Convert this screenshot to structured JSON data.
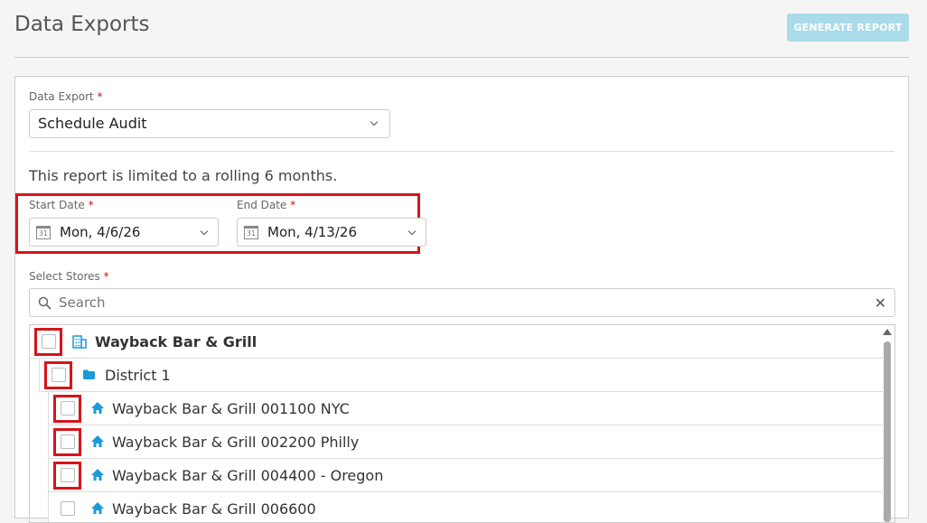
{
  "header": {
    "title": "Data Exports",
    "generate_label": "GENERATE REPORT"
  },
  "form": {
    "export_label": "Data Export",
    "required_mark": "*",
    "export_value": "Schedule Audit",
    "limit_note": "This report is limited to a rolling 6 months.",
    "start_label": "Start Date",
    "start_value": "Mon, 4/6/26",
    "end_label": "End Date",
    "end_value": "Mon, 4/13/26",
    "calendar_day": "31",
    "stores_label": "Select Stores",
    "search_placeholder": "Search"
  },
  "tree": {
    "org": "Wayback Bar & Grill",
    "district": "District 1",
    "stores": [
      "Wayback Bar & Grill 001100 NYC",
      "Wayback Bar & Grill 002200 Philly",
      "Wayback Bar & Grill 004400 - Oregon",
      "Wayback Bar & Grill 006600"
    ]
  },
  "colors": {
    "accent": "#1b9bd7",
    "highlight": "#d6141b",
    "button_bg": "#a9dbe8"
  }
}
